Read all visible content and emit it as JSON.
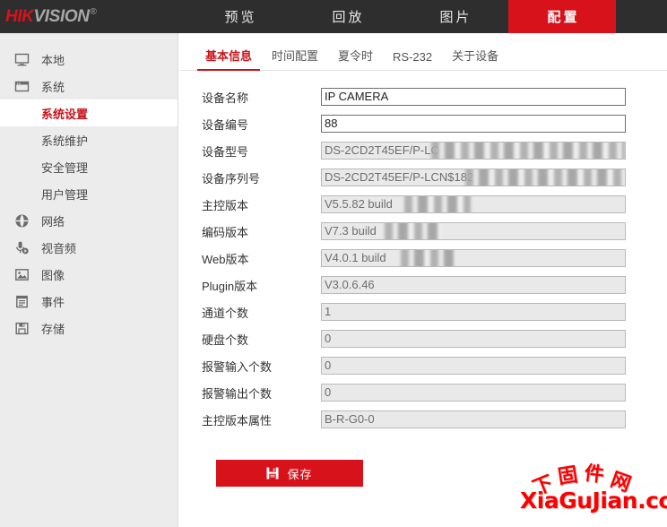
{
  "brand": {
    "part_red": "HIK",
    "part_gray": "VISION",
    "registered": "®"
  },
  "topnav": {
    "items": [
      {
        "label": "预览",
        "name": "live-view",
        "active": false
      },
      {
        "label": "回放",
        "name": "playback",
        "active": false
      },
      {
        "label": "图片",
        "name": "picture",
        "active": false
      },
      {
        "label": "配置",
        "name": "configuration",
        "active": true
      }
    ],
    "active_color": "#d8121a"
  },
  "sidebar": {
    "items": [
      {
        "label": "本地",
        "icon": "monitor-icon",
        "name": "local"
      },
      {
        "label": "系统",
        "icon": "window-icon",
        "name": "system"
      }
    ],
    "sub_items": [
      {
        "label": "系统设置",
        "name": "system-settings",
        "active": true
      },
      {
        "label": "系统维护",
        "name": "system-maintenance",
        "active": false
      },
      {
        "label": "安全管理",
        "name": "security-management",
        "active": false
      },
      {
        "label": "用户管理",
        "name": "user-management",
        "active": false
      }
    ],
    "items_after": [
      {
        "label": "网络",
        "icon": "globe-icon",
        "name": "network"
      },
      {
        "label": "视音频",
        "icon": "microphone-icon",
        "name": "video-audio"
      },
      {
        "label": "图像",
        "icon": "image-icon",
        "name": "image"
      },
      {
        "label": "事件",
        "icon": "event-icon",
        "name": "event"
      },
      {
        "label": "存储",
        "icon": "storage-icon",
        "name": "storage"
      }
    ],
    "active_color": "#c8141c"
  },
  "tabs": [
    {
      "label": "基本信息",
      "name": "basic-info",
      "active": true
    },
    {
      "label": "时间配置",
      "name": "time-settings",
      "active": false
    },
    {
      "label": "夏令时",
      "name": "dst",
      "active": false
    },
    {
      "label": "RS-232",
      "name": "rs232",
      "active": false
    },
    {
      "label": "关于设备",
      "name": "about-device",
      "active": false
    }
  ],
  "form": {
    "fields": [
      {
        "label": "设备名称",
        "value": "IP CAMERA",
        "name": "device-name",
        "disabled": false,
        "redacted": false
      },
      {
        "label": "设备编号",
        "value": "88",
        "name": "device-no",
        "disabled": false,
        "redacted": false
      },
      {
        "label": "设备型号",
        "value": "DS-2CD2T45EF/P-LC",
        "name": "device-model",
        "disabled": true,
        "redacted": true,
        "redact_start": 122,
        "redact_width": 216
      },
      {
        "label": "设备序列号",
        "value": "DS-2CD2T45EF/P-LCN$182",
        "name": "device-serial",
        "disabled": true,
        "redacted": true,
        "redact_start": 160,
        "redact_width": 178
      },
      {
        "label": "主控版本",
        "value": "V5.5.82 build",
        "name": "firmware-version",
        "disabled": true,
        "redacted": true,
        "redact_start": 92,
        "redact_width": 74
      },
      {
        "label": "编码版本",
        "value": "V7.3 build",
        "name": "encoding-version",
        "disabled": true,
        "redacted": true,
        "redact_start": 70,
        "redact_width": 64
      },
      {
        "label": "Web版本",
        "value": "V4.0.1 build",
        "name": "web-version",
        "disabled": true,
        "redacted": true,
        "redact_start": 88,
        "redact_width": 62
      },
      {
        "label": "Plugin版本",
        "value": "V3.0.6.46",
        "name": "plugin-version",
        "disabled": true,
        "redacted": false
      },
      {
        "label": "通道个数",
        "value": "1",
        "name": "channel-count",
        "disabled": true,
        "redacted": false
      },
      {
        "label": "硬盘个数",
        "value": "0",
        "name": "hdd-count",
        "disabled": true,
        "redacted": false
      },
      {
        "label": "报警输入个数",
        "value": "0",
        "name": "alarm-in-count",
        "disabled": true,
        "redacted": false
      },
      {
        "label": "报警输出个数",
        "value": "0",
        "name": "alarm-out-count",
        "disabled": true,
        "redacted": false
      },
      {
        "label": "主控版本属性",
        "value": "B-R-G0-0",
        "name": "firmware-attribute",
        "disabled": true,
        "redacted": false
      }
    ]
  },
  "save_button": {
    "label": "保存",
    "icon": "save-icon",
    "color": "#d8121a"
  },
  "watermark": {
    "arc_chars": [
      "下",
      "固",
      "件",
      "网"
    ],
    "domain": "XiaGuJian.com",
    "color": "#fe0000"
  }
}
